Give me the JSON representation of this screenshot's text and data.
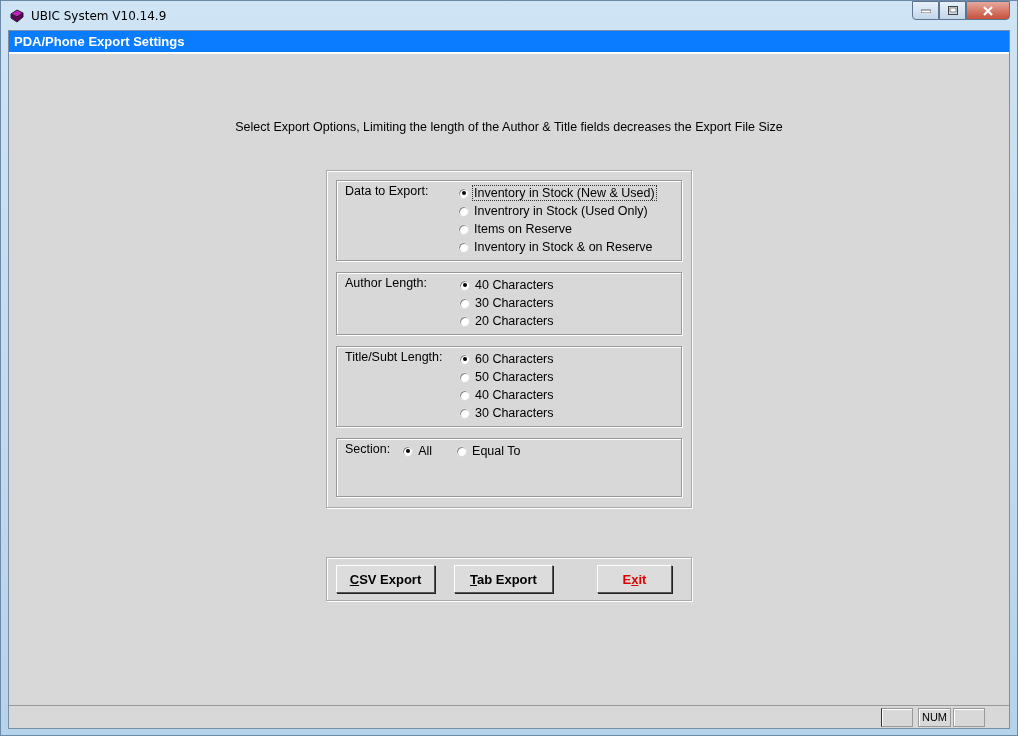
{
  "window": {
    "title": "UBIC System V10.14.9"
  },
  "form_title": "PDA/Phone Export Settings",
  "instruction": "Select Export Options, Limiting the length of the Author & Title fields decreases the Export File Size",
  "groups": [
    {
      "label": "Data to Export:",
      "kind": "vertical",
      "options": [
        {
          "label": "Inventory in Stock (New & Used)",
          "selected": true,
          "focused": true
        },
        {
          "label": "Inventrory in Stock (Used Only)",
          "selected": false,
          "focused": false
        },
        {
          "label": "Items on Reserve",
          "selected": false,
          "focused": false
        },
        {
          "label": "Inventory in Stock & on Reserve",
          "selected": false,
          "focused": false
        }
      ]
    },
    {
      "label": "Author Length:",
      "kind": "vertical",
      "options": [
        {
          "label": "40 Characters",
          "selected": true,
          "focused": false
        },
        {
          "label": "30 Characters",
          "selected": false,
          "focused": false
        },
        {
          "label": "20 Characters",
          "selected": false,
          "focused": false
        }
      ]
    },
    {
      "label": "Title/Subt Length:",
      "kind": "vertical",
      "options": [
        {
          "label": "60 Characters",
          "selected": true,
          "focused": false
        },
        {
          "label": "50 Characters",
          "selected": false,
          "focused": false
        },
        {
          "label": "40 Characters",
          "selected": false,
          "focused": false
        },
        {
          "label": "30 Characters",
          "selected": false,
          "focused": false
        }
      ]
    },
    {
      "label": "Section:",
      "kind": "horizontal",
      "options": [
        {
          "label": "All",
          "selected": true,
          "focused": false
        },
        {
          "label": "Equal To",
          "selected": false,
          "focused": false
        }
      ]
    }
  ],
  "buttons": [
    {
      "kind": "normal",
      "mnemonic": "C",
      "after": "SV Export"
    },
    {
      "kind": "normal",
      "mnemonic": "T",
      "after": "ab Export"
    },
    {
      "kind": "exit",
      "before": "E",
      "mnemonic": "x",
      "after": "it"
    }
  ],
  "status_bar": {
    "num": "NUM"
  }
}
